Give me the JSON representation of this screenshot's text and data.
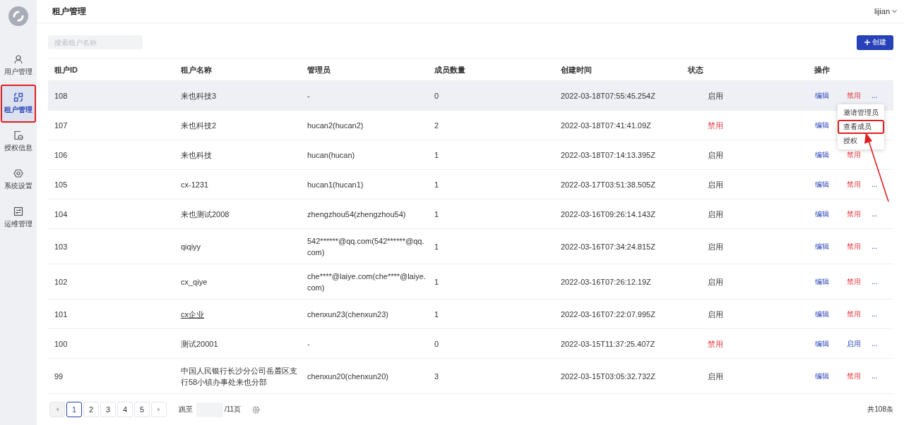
{
  "sidebar": {
    "items": [
      {
        "label": "用户管理",
        "selected": false,
        "annotated": false
      },
      {
        "label": "租户管理",
        "selected": true,
        "annotated": true
      },
      {
        "label": "授权信息",
        "selected": false,
        "annotated": false
      },
      {
        "label": "系统设置",
        "selected": false,
        "annotated": false
      },
      {
        "label": "运维管理",
        "selected": false,
        "annotated": false
      }
    ]
  },
  "header": {
    "title": "租户管理",
    "user": "lijian"
  },
  "search": {
    "placeholder": "搜索租户名称"
  },
  "create_button": {
    "label": "创建"
  },
  "table": {
    "columns": [
      "租户ID",
      "租户名称",
      "管理员",
      "成员数量",
      "创建时间",
      "状态",
      "操作"
    ],
    "rows": [
      {
        "id": "108",
        "name": "来也科技3",
        "link": false,
        "admin": "-",
        "members": "0",
        "created": "2022-03-18T07:55:45.254Z",
        "status": {
          "label": "启用",
          "enabled": true
        },
        "edit": "编辑",
        "toggle": {
          "label": "禁用",
          "kind": "disable"
        },
        "more": "...",
        "highlighted": true
      },
      {
        "id": "107",
        "name": "来也科技2",
        "link": false,
        "admin": "hucan2(hucan2)",
        "members": "2",
        "created": "2022-03-18T07:41:41.09Z",
        "status": {
          "label": "禁用",
          "enabled": false
        },
        "edit": "编辑",
        "toggle": null,
        "more": null,
        "highlighted": false
      },
      {
        "id": "106",
        "name": "来也科技",
        "link": false,
        "admin": "hucan(hucan)",
        "members": "1",
        "created": "2022-03-18T07:14:13.395Z",
        "status": {
          "label": "启用",
          "enabled": true
        },
        "edit": "编辑",
        "toggle": {
          "label": "禁用",
          "kind": "disable"
        },
        "more": null,
        "highlighted": false
      },
      {
        "id": "105",
        "name": "cx-1231",
        "link": false,
        "admin": "hucan1(hucan1)",
        "members": "1",
        "created": "2022-03-17T03:51:38.505Z",
        "status": {
          "label": "启用",
          "enabled": true
        },
        "edit": "编辑",
        "toggle": {
          "label": "禁用",
          "kind": "disable"
        },
        "more": "...",
        "highlighted": false
      },
      {
        "id": "104",
        "name": "来也测试2008",
        "link": false,
        "admin": "zhengzhou54(zhengzhou54)",
        "members": "1",
        "created": "2022-03-16T09:26:14.143Z",
        "status": {
          "label": "启用",
          "enabled": true
        },
        "edit": "编辑",
        "toggle": {
          "label": "禁用",
          "kind": "disable"
        },
        "more": "...",
        "highlighted": false
      },
      {
        "id": "103",
        "name": "qiqiyy",
        "link": false,
        "admin": "542******@qq.com(542******@qq.com)",
        "members": "1",
        "created": "2022-03-16T07:34:24.815Z",
        "status": {
          "label": "启用",
          "enabled": true
        },
        "edit": "编辑",
        "toggle": {
          "label": "禁用",
          "kind": "disable"
        },
        "more": "...",
        "highlighted": false
      },
      {
        "id": "102",
        "name": "cx_qiye",
        "link": false,
        "admin": "che****@laiye.com(che****@laiye.com)",
        "members": "1",
        "created": "2022-03-16T07:26:12.19Z",
        "status": {
          "label": "启用",
          "enabled": true
        },
        "edit": "编辑",
        "toggle": {
          "label": "禁用",
          "kind": "disable"
        },
        "more": "...",
        "highlighted": false
      },
      {
        "id": "101",
        "name": "cx企业",
        "link": true,
        "admin": "chenxun23(chenxun23)",
        "members": "1",
        "created": "2022-03-16T07:22:07.995Z",
        "status": {
          "label": "启用",
          "enabled": true
        },
        "edit": "编辑",
        "toggle": {
          "label": "禁用",
          "kind": "disable"
        },
        "more": "...",
        "highlighted": false
      },
      {
        "id": "100",
        "name": "测试20001",
        "link": false,
        "admin": "-",
        "members": "0",
        "created": "2022-03-15T11:37:25.407Z",
        "status": {
          "label": "禁用",
          "enabled": false
        },
        "edit": "编辑",
        "toggle": {
          "label": "启用",
          "kind": "enable"
        },
        "more": "...",
        "highlighted": false
      },
      {
        "id": "99",
        "name": "中国人民银行长沙分公司岳麓区支行58小镇办事处来也分部",
        "link": false,
        "admin": "chenxun20(chenxun20)",
        "members": "3",
        "created": "2022-03-15T03:05:32.732Z",
        "status": {
          "label": "启用",
          "enabled": true
        },
        "edit": "编辑",
        "toggle": {
          "label": "禁用",
          "kind": "disable"
        },
        "more": "...",
        "highlighted": false
      }
    ]
  },
  "dropdown": {
    "items": [
      {
        "label": "邀请管理员",
        "annotated": false
      },
      {
        "label": "查看成员",
        "annotated": true
      },
      {
        "label": "授权",
        "annotated": false
      }
    ]
  },
  "pagination": {
    "pages": [
      {
        "label": "1",
        "selected": true
      },
      {
        "label": "2",
        "selected": false
      },
      {
        "label": "3",
        "selected": false
      },
      {
        "label": "4",
        "selected": false
      },
      {
        "label": "5",
        "selected": false
      }
    ],
    "jump_label": "跳至",
    "page_total": "/11页",
    "total": "共108条"
  }
}
